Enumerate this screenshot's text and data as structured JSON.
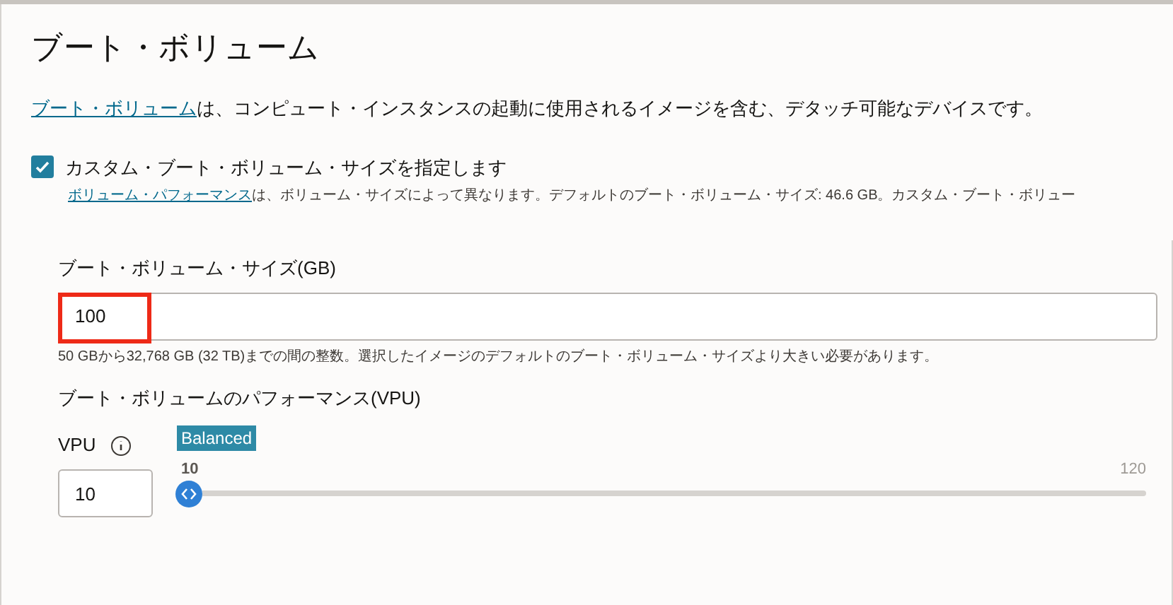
{
  "title": "ブート・ボリューム",
  "intro": {
    "link": "ブート・ボリューム",
    "text": "は、コンピュート・インスタンスの起動に使用されるイメージを含む、デタッチ可能なデバイスです。"
  },
  "custom_size": {
    "label": "カスタム・ブート・ボリューム・サイズを指定します",
    "checked": true,
    "help_link": "ボリューム・パフォーマンス",
    "help_text": "は、ボリューム・サイズによって異なります。デフォルトのブート・ボリューム・サイズ: 46.6 GB。カスタム・ブート・ボリュー"
  },
  "size_field": {
    "label": "ブート・ボリューム・サイズ(GB)",
    "value": "100",
    "highlighted": true,
    "hint": "50 GBから32,768 GB (32 TB)までの間の整数。選択したイメージのデフォルトのブート・ボリューム・サイズより大きい必要があります。"
  },
  "performance": {
    "heading": "ブート・ボリュームのパフォーマンス(VPU)",
    "vpu_label": "VPU",
    "vpu_value": "10",
    "badge": "Balanced",
    "min": "10",
    "max": "120",
    "level": 0
  }
}
